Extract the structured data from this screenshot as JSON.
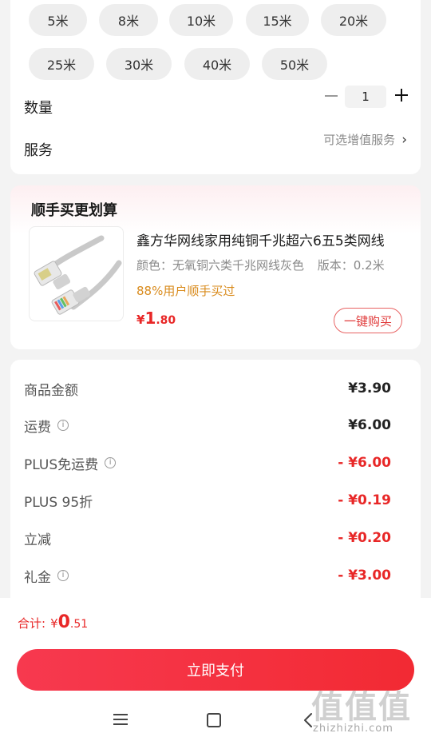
{
  "spec": {
    "lengths": [
      {
        "label": "5米"
      },
      {
        "label": "8米"
      },
      {
        "label": "10米"
      },
      {
        "label": "15米"
      },
      {
        "label": "20米"
      },
      {
        "label": "25米"
      },
      {
        "label": "30米"
      },
      {
        "label": "40米"
      },
      {
        "label": "50米"
      }
    ],
    "quantity_label": "数量",
    "quantity_value": "1",
    "service_label": "服务",
    "service_link": "可选增值服务",
    "service_arrow": "›"
  },
  "bundle": {
    "title": "顺手买更划算",
    "product": {
      "name": "鑫方华网线家用纯铜千兆超六6五5类网线",
      "color_spec": "颜色：无氧铜六类千兆网线灰色",
      "version_spec": "版本：0.2米",
      "social_proof": "88%用户顺手买过",
      "price_currency": "¥",
      "price_int": "1",
      "price_dec": ".80",
      "buy_button": "一键购买"
    }
  },
  "summary": {
    "rows": [
      {
        "label": "商品金额",
        "value": "¥3.90",
        "info": false,
        "discount": false
      },
      {
        "label": "运费",
        "value": "¥6.00",
        "info": true,
        "discount": false
      },
      {
        "label": "PLUS免运费",
        "value": "- ¥6.00",
        "info": true,
        "discount": true
      },
      {
        "label": "PLUS 95折",
        "value": "- ¥0.19",
        "info": false,
        "discount": true
      },
      {
        "label": "立减",
        "value": "- ¥0.20",
        "info": false,
        "discount": true
      },
      {
        "label": "礼金",
        "value": "- ¥3.00",
        "info": true,
        "discount": true
      }
    ],
    "info_glyph": "i"
  },
  "footer": {
    "total_label": "合计:",
    "total_currency": "¥",
    "total_int": "0",
    "total_dec": ".51",
    "pay_button": "立即支付"
  },
  "watermark": {
    "big": "值值值",
    "small": "zhizhizhi.com"
  },
  "colors": {
    "accent": "#e82727",
    "pay_gradient_start": "#f7394f",
    "pay_gradient_end": "#f22a33",
    "social_proof": "#d98b1d"
  }
}
